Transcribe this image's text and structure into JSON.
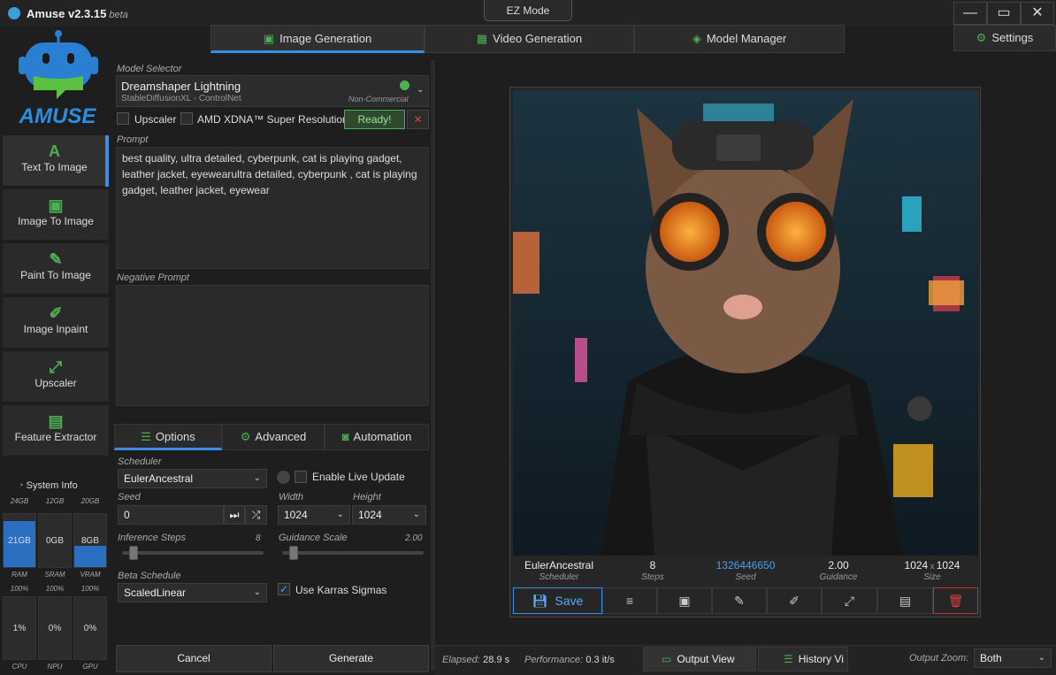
{
  "app": {
    "title": "Amuse v2.3.15",
    "beta": "beta",
    "ez_mode": "EZ Mode",
    "logo_text": "AMUSE"
  },
  "window": {
    "minimize": "—",
    "maximize": "▭",
    "close": "✕"
  },
  "tabs": [
    {
      "label": "Image Generation",
      "icon": "image-icon"
    },
    {
      "label": "Video Generation",
      "icon": "film-icon"
    },
    {
      "label": "Model Manager",
      "icon": "layers-icon"
    }
  ],
  "settings": {
    "label": "Settings"
  },
  "nav": [
    {
      "label": "Text To Image",
      "glyph": "A"
    },
    {
      "label": "Image To Image",
      "glyph": "▣"
    },
    {
      "label": "Paint To Image",
      "glyph": "✎"
    },
    {
      "label": "Image Inpaint",
      "glyph": "✐"
    },
    {
      "label": "Upscaler",
      "glyph": "⤢"
    },
    {
      "label": "Feature Extractor",
      "glyph": "▤"
    }
  ],
  "system_info": {
    "title": "System Info",
    "memory": [
      {
        "total": "24GB",
        "value": "21GB",
        "label": "RAM",
        "fill": 0.87
      },
      {
        "total": "12GB",
        "value": "0GB",
        "label": "SRAM",
        "fill": 0
      },
      {
        "total": "20GB",
        "value": "8GB",
        "label": "VRAM",
        "fill": 0.4
      }
    ],
    "usage": [
      {
        "total": "100%",
        "value": "1%",
        "label": "CPU"
      },
      {
        "total": "100%",
        "value": "0%",
        "label": "NPU"
      },
      {
        "total": "100%",
        "value": "0%",
        "label": "GPU"
      }
    ]
  },
  "model": {
    "label": "Model Selector",
    "name": "Dreamshaper Lightning",
    "sub": "StableDiffusionXL - ControlNet",
    "license": "Non-Commercial",
    "status_color": "#4caf50"
  },
  "options_row": {
    "upscaler": "Upscaler",
    "xdna": "AMD XDNA™ Super Resolution",
    "ready": "Ready!",
    "cancel": "✕"
  },
  "prompt": {
    "label": "Prompt",
    "value": "best quality, ultra detailed, cyberpunk, cat is playing gadget, leather jacket, eyewearultra detailed, cyberpunk , cat is playing gadget, leather jacket, eyewear"
  },
  "negative_prompt": {
    "label": "Negative Prompt",
    "value": ""
  },
  "subtabs": [
    {
      "label": "Options",
      "icon": "sliders-icon"
    },
    {
      "label": "Advanced",
      "icon": "gears-icon"
    },
    {
      "label": "Automation",
      "icon": "robot-icon"
    }
  ],
  "params": {
    "scheduler_label": "Scheduler",
    "scheduler": "EulerAncestral",
    "live_update": "Enable Live Update",
    "seed_label": "Seed",
    "seed": "0",
    "width_label": "Width",
    "width": "1024",
    "height_label": "Height",
    "height": "1024",
    "steps_label": "Inference Steps",
    "steps": "8",
    "steps_fraction": 0.05,
    "guidance_label": "Guidance Scale",
    "guidance": "2.00",
    "guidance_fraction": 0.05,
    "beta_label": "Beta Schedule",
    "beta": "ScaledLinear",
    "karras": "Use Karras Sigmas"
  },
  "actions": {
    "cancel": "Cancel",
    "generate": "Generate"
  },
  "result": {
    "meta": [
      {
        "value": "EulerAncestral",
        "label": "Scheduler"
      },
      {
        "value": "8",
        "label": "Steps"
      },
      {
        "value": "1326446650",
        "label": "Seed"
      },
      {
        "value": "2.00",
        "label": "Guidance"
      },
      {
        "value": "1024",
        "value2": "1024",
        "label": "Size"
      }
    ],
    "save": "Save"
  },
  "status": {
    "elapsed_label": "Elapsed:",
    "elapsed": "28.9 s",
    "perf_label": "Performance:",
    "perf": "0.3 it/s",
    "output_view": "Output View",
    "history_view": "History Vi",
    "zoom_label": "Output Zoom:",
    "zoom": "Both"
  }
}
